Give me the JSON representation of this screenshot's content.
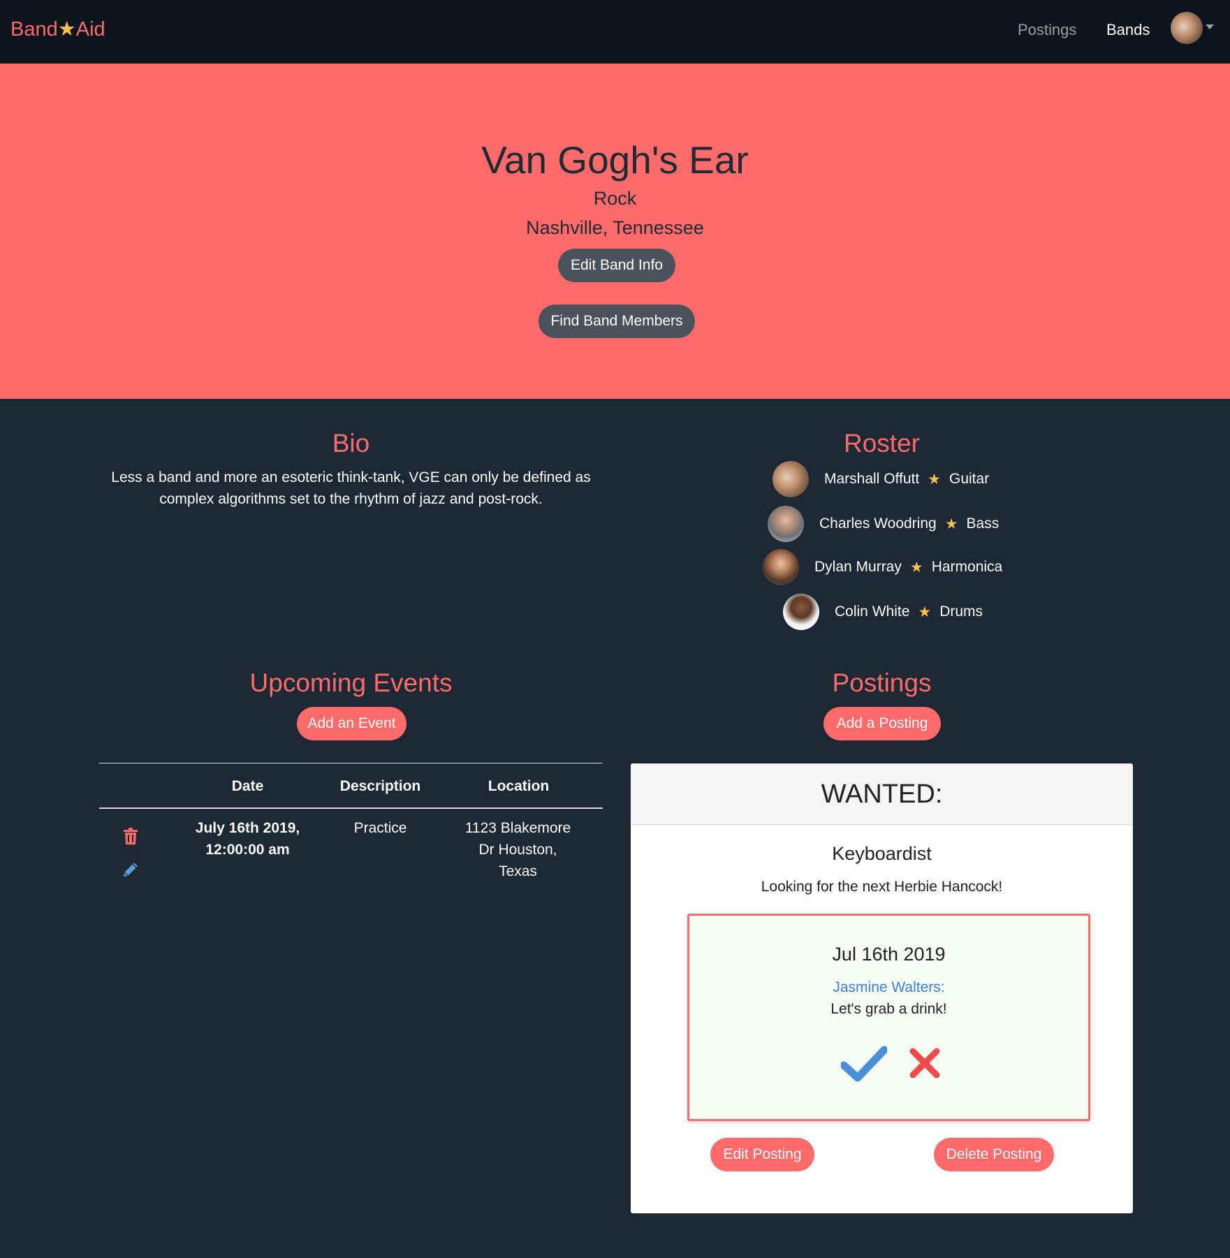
{
  "nav": {
    "brand_left": "Band",
    "brand_star": "★",
    "brand_right": "Aid",
    "links": [
      "Postings",
      "Bands"
    ],
    "avatar_icon": "user-avatar",
    "colors": {
      "background": "#0e141b",
      "brand": "#ff6b6b",
      "star": "#f7c04a"
    }
  },
  "hero": {
    "band_name": "Van Gogh's Ear",
    "genre": "Rock",
    "location": "Nashville, Tennessee",
    "edit_button": "Edit Band Info",
    "find_button": "Find Band Members",
    "background": "#ff6b6b"
  },
  "bio": {
    "title": "Bio",
    "text": "Less a band and more an esoteric think-tank, VGE can only be defined as complex algorithms set to the rhythm of jazz and post-rock."
  },
  "roster": {
    "title": "Roster",
    "separator": "★",
    "members": [
      {
        "name": "Marshall Offutt",
        "instrument": "Guitar"
      },
      {
        "name": "Charles Woodring",
        "instrument": "Bass"
      },
      {
        "name": "Dylan Murray",
        "instrument": "Harmonica"
      },
      {
        "name": "Colin White",
        "instrument": "Drums"
      }
    ]
  },
  "events": {
    "title": "Upcoming Events",
    "add_button": "Add an Event",
    "columns": [
      "Date",
      "Description",
      "Location"
    ],
    "rows": [
      {
        "date": "July 16th 2019, 12:00:00 am",
        "description": "Practice",
        "location": "1123 Blakemore Dr Houston, Texas",
        "actions": [
          "trash-icon",
          "pencil-icon"
        ]
      }
    ]
  },
  "postings": {
    "title": "Postings",
    "add_button": "Add a Posting",
    "card": {
      "header": "WANTED:",
      "role": "Keyboardist",
      "description": "Looking for the next Herbie Hancock!",
      "response": {
        "date": "Jul 16th 2019",
        "name": "Jasmine Walters:",
        "message": "Let's grab a drink!",
        "accept_icon": "check-icon",
        "reject_icon": "x-icon"
      },
      "edit_button": "Edit Posting",
      "delete_button": "Delete Posting"
    }
  }
}
